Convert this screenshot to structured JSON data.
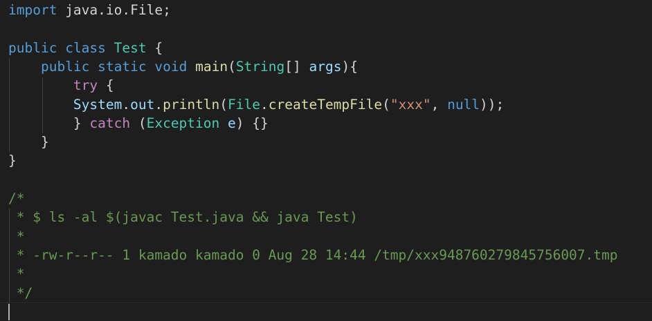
{
  "editor": {
    "lines": [
      [
        {
          "c": "kw",
          "t": "import"
        },
        {
          "c": "plain",
          "t": " java.io.File;"
        }
      ],
      [],
      [
        {
          "c": "kw",
          "t": "public"
        },
        {
          "c": "plain",
          "t": " "
        },
        {
          "c": "kw",
          "t": "class"
        },
        {
          "c": "plain",
          "t": " "
        },
        {
          "c": "type",
          "t": "Test"
        },
        {
          "c": "plain",
          "t": " {"
        }
      ],
      [
        {
          "c": "plain",
          "t": "    "
        },
        {
          "c": "kw",
          "t": "public"
        },
        {
          "c": "plain",
          "t": " "
        },
        {
          "c": "kw",
          "t": "static"
        },
        {
          "c": "plain",
          "t": " "
        },
        {
          "c": "kw",
          "t": "void"
        },
        {
          "c": "plain",
          "t": " "
        },
        {
          "c": "fn",
          "t": "main"
        },
        {
          "c": "plain",
          "t": "("
        },
        {
          "c": "type",
          "t": "String"
        },
        {
          "c": "plain",
          "t": "[] "
        },
        {
          "c": "var",
          "t": "args"
        },
        {
          "c": "plain",
          "t": "){"
        }
      ],
      [
        {
          "c": "plain",
          "t": "        "
        },
        {
          "c": "ctrl",
          "t": "try"
        },
        {
          "c": "plain",
          "t": " {"
        }
      ],
      [
        {
          "c": "plain",
          "t": "        "
        },
        {
          "c": "var",
          "t": "System"
        },
        {
          "c": "plain",
          "t": "."
        },
        {
          "c": "var",
          "t": "out"
        },
        {
          "c": "plain",
          "t": "."
        },
        {
          "c": "fn",
          "t": "println"
        },
        {
          "c": "plain",
          "t": "("
        },
        {
          "c": "type",
          "t": "File"
        },
        {
          "c": "plain",
          "t": "."
        },
        {
          "c": "fn",
          "t": "createTempFile"
        },
        {
          "c": "plain",
          "t": "("
        },
        {
          "c": "str",
          "t": "\"xxx\""
        },
        {
          "c": "plain",
          "t": ", "
        },
        {
          "c": "kw",
          "t": "null"
        },
        {
          "c": "plain",
          "t": "));"
        }
      ],
      [
        {
          "c": "plain",
          "t": "        } "
        },
        {
          "c": "ctrl",
          "t": "catch"
        },
        {
          "c": "plain",
          "t": " ("
        },
        {
          "c": "type",
          "t": "Exception"
        },
        {
          "c": "plain",
          "t": " "
        },
        {
          "c": "var",
          "t": "e"
        },
        {
          "c": "plain",
          "t": ") {}"
        }
      ],
      [
        {
          "c": "plain",
          "t": "    }"
        }
      ],
      [
        {
          "c": "plain",
          "t": "}"
        }
      ],
      [],
      [
        {
          "c": "cmt",
          "t": "/*"
        }
      ],
      [
        {
          "c": "cmt",
          "t": " * $ ls -al $(javac Test.java && java Test)"
        }
      ],
      [
        {
          "c": "cmt",
          "t": " *"
        }
      ],
      [
        {
          "c": "cmt",
          "t": " * -rw-r--r-- 1 kamado kamado 0 Aug 28 14:44 /tmp/xxx948760279845756007.tmp"
        }
      ],
      [
        {
          "c": "cmt",
          "t": " *"
        }
      ],
      [
        {
          "c": "cmt",
          "t": " */"
        }
      ]
    ]
  }
}
